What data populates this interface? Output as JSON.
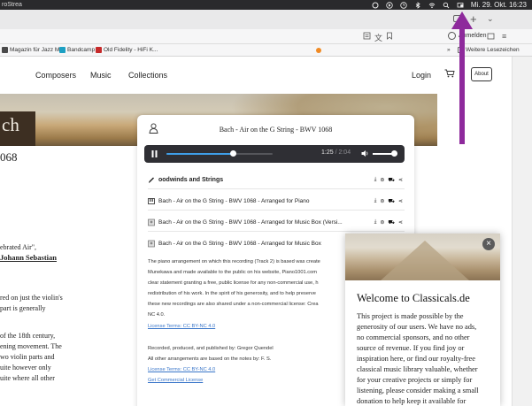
{
  "menubar": {
    "tab_fragment": "roStrea",
    "datetime": "Mi. 29. Okt. 16:23"
  },
  "toolbar": {
    "account_label": "Anmelden"
  },
  "bookmarks": {
    "items": [
      {
        "label": "Magazin für Jazz M...",
        "color": "#4a4a4a"
      },
      {
        "label": "Bandcamp",
        "color": "#1da0c3"
      },
      {
        "label": "Old Fidelity - HiFi K...",
        "color": "#c62a2a"
      }
    ],
    "overflow_label": "»",
    "other_label": "Weitere Lesezeichen"
  },
  "site": {
    "nav": [
      {
        "label": "Composers"
      },
      {
        "label": "Music"
      },
      {
        "label": "Collections"
      }
    ],
    "login_label": "Login",
    "about_label": "About",
    "hero_text": "ch",
    "left_column": [
      {
        "text": "068"
      },
      {
        "text": "ebrated Air\","
      },
      {
        "text": "Johann Sebastian"
      },
      {
        "text": "red on just the violin's"
      },
      {
        "text": "part is generally"
      },
      {
        "text": "of the 18th century,"
      },
      {
        "text": "ening movement. The"
      },
      {
        "text": "wo violin parts and"
      },
      {
        "text": "uite however only"
      },
      {
        "text": "uite where all other"
      }
    ]
  },
  "player_card": {
    "title": "Bach - Air on the G String - BWV 1068",
    "progress": 0.625,
    "time_current": "1:25",
    "time_total": "/ 2:04",
    "volume": 0.85,
    "tracks": [
      {
        "label": "oodwinds and Strings",
        "header": true
      },
      {
        "label": "Bach - Air on the G String - BWV 1068 - Arranged for Piano"
      },
      {
        "label": "Bach - Air on the G String - BWV 1068 - Arranged for Music Box (Versi..."
      },
      {
        "label": "Bach - Air on the G String - BWV 1068 - Arranged for Music Box"
      }
    ],
    "description": [
      "The piano arrangement on which this recording (Track 2) is based was create",
      "Munekawa and made available to the public on his website, Piano1001.com",
      "clear statement granting a free, public license for any non-commercial use, h",
      "redistribution of his work. In the spirit of his generosity, and to help preserve",
      "these new recordings are also shared under a non-commercial license: Crea",
      "NC 4.0."
    ],
    "license_link_1": "License Terms: CC BY-NC 4.0",
    "credits": [
      "Recorded, produced, and published by: Gregor Quendel",
      "All other arrangements are based on the notes by: F. S."
    ],
    "license_link_2": "License Terms: CC BY-NC 4.0",
    "commercial_link": "Get Commercial License"
  },
  "popup": {
    "title": "Welcome to Classicals.de",
    "lines": [
      "This project is made possible by the",
      "generosity of our users. We have no ads,",
      "no commercial sponsors, and no other",
      "source of revenue. If you find joy or",
      "inspiration here, or find our royalty-free",
      "classical music library valuable, whether",
      "for your creative projects or simply for",
      "listening, please consider making a small",
      "donation to help keep it available for"
    ]
  },
  "colors": {
    "annotation_arrow": "#8e2a9c",
    "player_bg": "#2f2f34",
    "progress": "#3f9fe8",
    "link": "#3a76c9"
  }
}
